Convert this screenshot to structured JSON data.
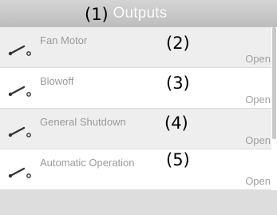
{
  "header": {
    "title": "Outputs"
  },
  "callouts": [
    "(1)",
    "(2)",
    "(3)",
    "(4)",
    "(5)"
  ],
  "outputs": [
    {
      "label": "Fan Motor",
      "state": "Open",
      "icon": "open-switch-icon"
    },
    {
      "label": "Blowoff",
      "state": "Open",
      "icon": "open-switch-icon"
    },
    {
      "label": "General Shutdown",
      "state": "Open",
      "icon": "open-switch-icon"
    },
    {
      "label": "Automatic Operation",
      "state": "Open",
      "icon": "open-switch-icon"
    }
  ],
  "colors": {
    "header_bg": "#c8c8c8",
    "row_alt_bg": "#eeeeee",
    "text_muted": "#9a9a9a",
    "footer_bg": "#dddddd"
  }
}
